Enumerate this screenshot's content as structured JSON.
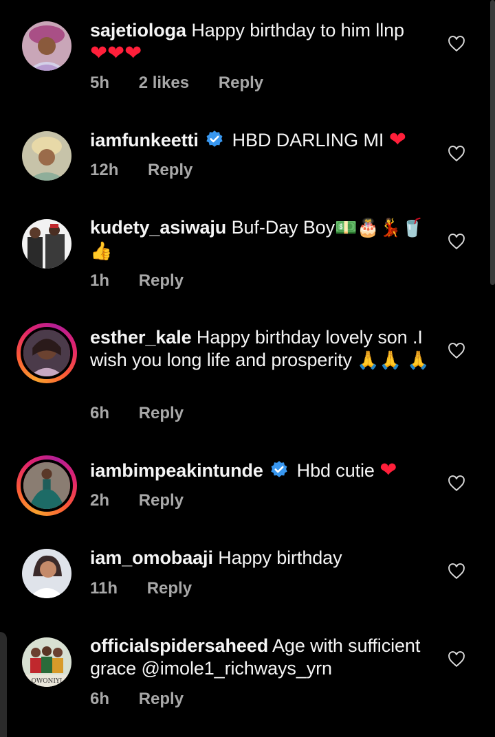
{
  "colors": {
    "background": "#000000",
    "text": "#f5f5f5",
    "meta": "#a8a8a8",
    "heart": "#ff1f3a",
    "verified": "#3897f0"
  },
  "comments": [
    {
      "username": "sajetiologa",
      "text": "Happy birthday to him llnp",
      "emoji": "❤️❤️❤️",
      "time": "5h",
      "likes": "2 likes",
      "reply": "Reply",
      "verified": false,
      "story_ring": false
    },
    {
      "username": "iamfunkeetti",
      "text": "HBD DARLING MI",
      "emoji": "❤️",
      "time": "12h",
      "reply": "Reply",
      "verified": true,
      "story_ring": false
    },
    {
      "username": "kudety_asiwaju",
      "text": "Buf-Day Boy",
      "emoji": "💵🎂💃🥤👍",
      "time": "1h",
      "reply": "Reply",
      "verified": false,
      "story_ring": false
    },
    {
      "username": "esther_kale",
      "text": "Happy birthday lovely son .I wish you long life and prosperity",
      "emoji": "🙏🙏🙏",
      "time": "6h",
      "reply": "Reply",
      "verified": false,
      "story_ring": true
    },
    {
      "username": "iambimpeakintunde",
      "text": "Hbd cutie",
      "emoji": "❤️",
      "time": "2h",
      "reply": "Reply",
      "verified": true,
      "story_ring": true
    },
    {
      "username": "iam_omobaaji",
      "text": "Happy birthday",
      "time": "11h",
      "reply": "Reply",
      "verified": false,
      "story_ring": false
    },
    {
      "username": "officialspidersaheed",
      "text": "Age with sufficient grace @imole1_richways_yrn",
      "time": "6h",
      "reply": "Reply",
      "verified": false,
      "story_ring": false
    }
  ]
}
